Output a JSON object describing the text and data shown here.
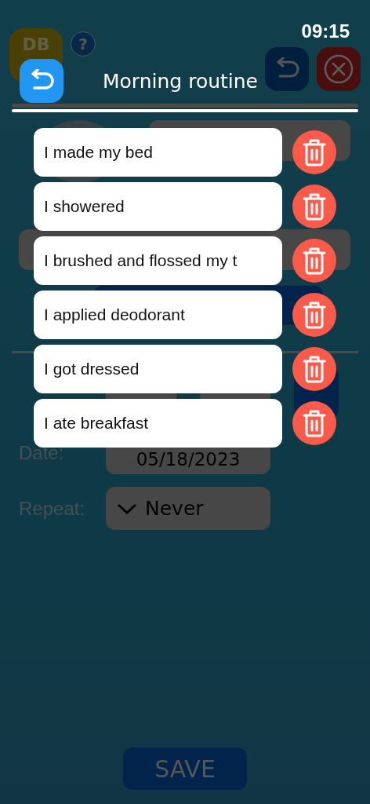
{
  "status_bar": {
    "time": "09:15"
  },
  "edit_task": {
    "logo": "DB",
    "help": "?",
    "date_label": "Date:",
    "date": "05/18/2023",
    "repeat_label": "Repeat:",
    "repeat": "Never",
    "save": "SAVE"
  },
  "dialog": {
    "title": "Morning routine",
    "items": [
      {
        "label": "I made my bed"
      },
      {
        "label": "I showered"
      },
      {
        "label": "I brushed and flossed my t"
      },
      {
        "label": "I applied deodorant"
      },
      {
        "label": "I got dressed"
      },
      {
        "label": "I ate breakfast"
      }
    ]
  }
}
